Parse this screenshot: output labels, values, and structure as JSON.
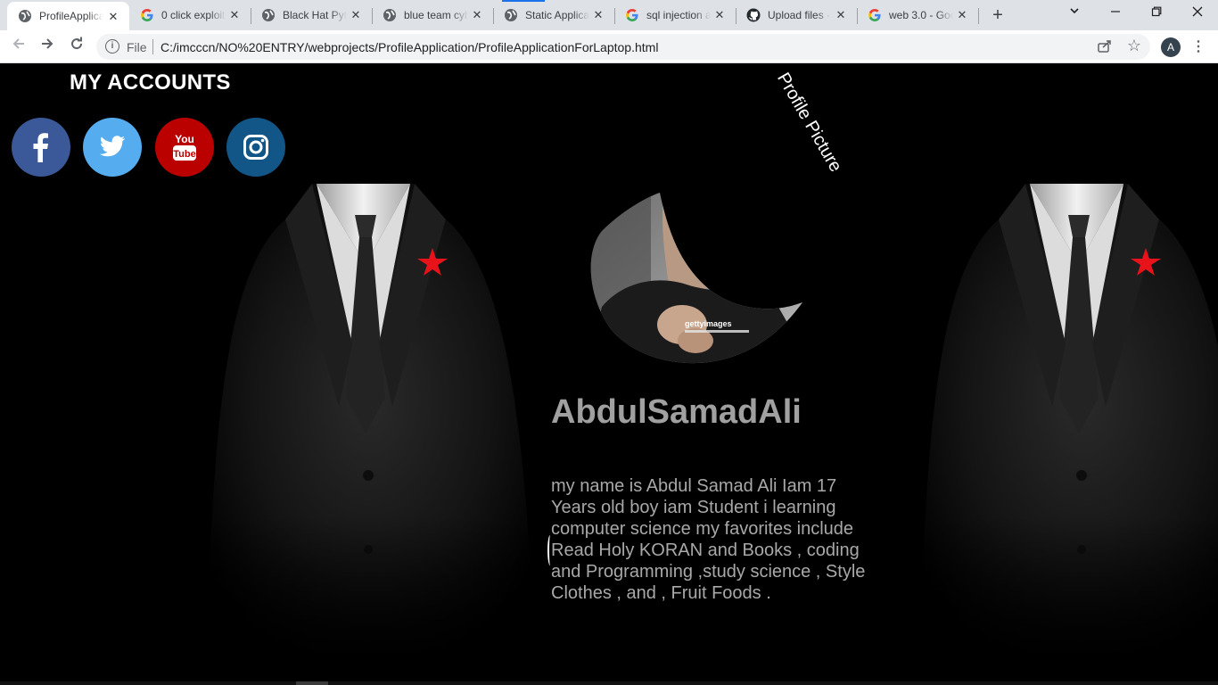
{
  "browser": {
    "tabs": [
      {
        "title": "ProfileApplica",
        "icon": "globe-icon"
      },
      {
        "title": "0 click exploit",
        "icon": "google-icon"
      },
      {
        "title": "Black Hat Pyth",
        "icon": "globe-icon"
      },
      {
        "title": "blue team cyb",
        "icon": "globe-icon"
      },
      {
        "title": "Static Applica",
        "icon": "globe-icon"
      },
      {
        "title": "sql injection a",
        "icon": "google-icon"
      },
      {
        "title": "Upload files ·",
        "icon": "github-icon"
      },
      {
        "title": "web 3.0 - Goo",
        "icon": "google-icon"
      }
    ],
    "address": {
      "scheme_label": "File",
      "url": "C:/imcccn/NO%20ENTRY/webprojects/ProfileApplication/ProfileApplicationForLaptop.html"
    },
    "profile_initial": "A"
  },
  "page": {
    "accounts_title": "MY ACCOUNTS",
    "social": [
      {
        "name": "facebook",
        "color": "#3b5998"
      },
      {
        "name": "twitter",
        "color": "#55acee"
      },
      {
        "name": "youtube",
        "color": "#bb0000",
        "label_top": "You",
        "label_bottom": "Tube"
      },
      {
        "name": "instagram",
        "color": "#125688"
      }
    ],
    "profile_picture_label": "Profile Picture",
    "photo_watermark": "gettyimages",
    "name": "AbdulSamadAli",
    "bio": "my name is Abdul Samad Ali Iam 17 Years old boy iam Student i learning computer science my favorites include Read Holy KORAN and Books , coding and Programming ,study science , Style Clothes , and , Fruit Foods ."
  }
}
